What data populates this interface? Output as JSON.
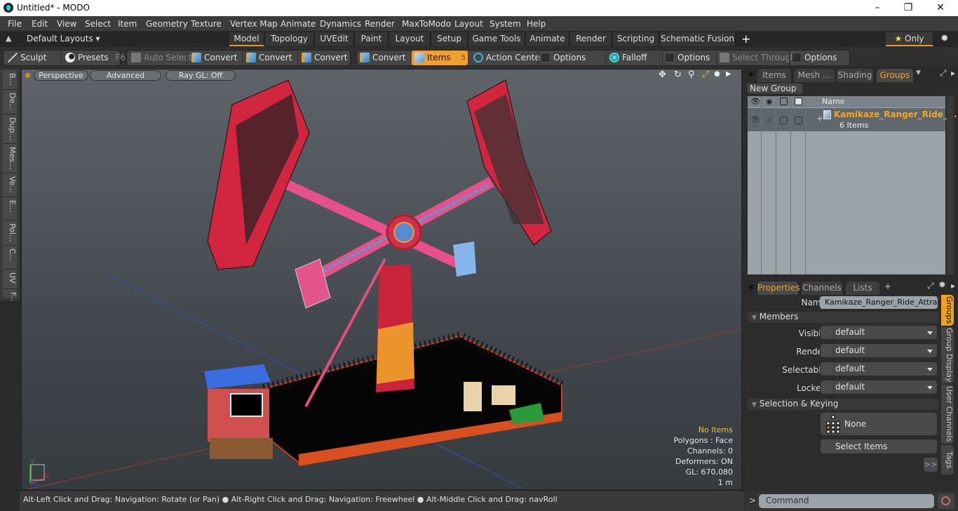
{
  "window": {
    "title": "Untitled* - MODO",
    "minimize": "–",
    "maximize": "❐",
    "close": "✕"
  },
  "menu": [
    "File",
    "Edit",
    "View",
    "Select",
    "Item",
    "Geometry",
    "Texture",
    "Vertex Map",
    "Animate",
    "Dynamics",
    "Render",
    "MaxToModo",
    "Layout",
    "System",
    "Help"
  ],
  "layouts": {
    "default_label": "Default Layouts ▾",
    "tabs": [
      "Model",
      "Topology",
      "UVEdit",
      "Paint",
      "Layout",
      "Setup",
      "Game Tools",
      "Animate",
      "Render",
      "Scripting",
      "Schematic Fusion"
    ],
    "active_tab": "Model",
    "add_label": "+",
    "only_label": "Only"
  },
  "toolbar": {
    "sculpt": "Sculpt",
    "presets": "Presets",
    "presets_key": "F6",
    "auto_select": "Auto Select",
    "convert1": "Convert",
    "convert2": "Convert",
    "convert3": "Convert",
    "convert4": "Convert",
    "items": "Items",
    "items_count": "5",
    "action_center": "Action Center",
    "options1": "Options",
    "falloff": "Falloff",
    "options2": "Options",
    "select_through": "Select Through",
    "options3": "Options"
  },
  "left_tabs": [
    "B...",
    "De...",
    "Dup...",
    "Mes...",
    "Ve...",
    "E...",
    "Pol...",
    "C...",
    "UV",
    "F..."
  ],
  "viewport": {
    "view_mode": "Perspective",
    "shading": "Advanced",
    "raygl": "Ray GL: Off",
    "stats": {
      "selection": "No Items",
      "polygons": "Polygons : Face",
      "channels": "Channels: 0",
      "deformers": "Deformers: ON",
      "gl": "GL: 670,080",
      "scale": "1 m"
    },
    "axis_labels": {
      "y": "Y",
      "x": "X",
      "z": "Z"
    }
  },
  "statusbar": {
    "hint1": "Alt-Left Click and Drag: Navigation: Rotate (or Pan)",
    "hint2": "Alt-Right Click and Drag: Navigation: Freewheel",
    "hint3": "Alt-Middle Click and Drag: navRoll"
  },
  "groups_panel": {
    "tabs": [
      "Items",
      "Mesh ...",
      "Shading",
      "Groups"
    ],
    "active_tab": "Groups",
    "new_group": "New Group",
    "column_name": "Name",
    "rows": [
      {
        "name": "Kamikaze_Ranger_Ride_...",
        "sub": "6 Items"
      }
    ]
  },
  "properties_panel": {
    "tabs": [
      "Properties",
      "Channels",
      "Lists"
    ],
    "active_tab": "Properties",
    "add": "+",
    "name_label": "Name",
    "name_value": "Kamikaze_Ranger_Ride_Attractio",
    "members_label": "Members",
    "fields": [
      {
        "label": "Visible",
        "value": "default"
      },
      {
        "label": "Render",
        "value": "default"
      },
      {
        "label": "Selectable",
        "value": "default"
      },
      {
        "label": "Locked",
        "value": "default"
      }
    ],
    "selection_keying_label": "Selection & Keying",
    "none_label": "None",
    "select_items": "Select Items",
    "more": ">>",
    "side_tabs": [
      "Groups",
      "Group Display",
      "User Channels",
      "Tags"
    ],
    "active_side_tab": "Groups"
  },
  "command": {
    "prompt": ">",
    "placeholder": "Command"
  },
  "colors": {
    "accent": "#f0a020",
    "active_tab_underline": "#e89a2a",
    "items_button": "#f0a030"
  }
}
